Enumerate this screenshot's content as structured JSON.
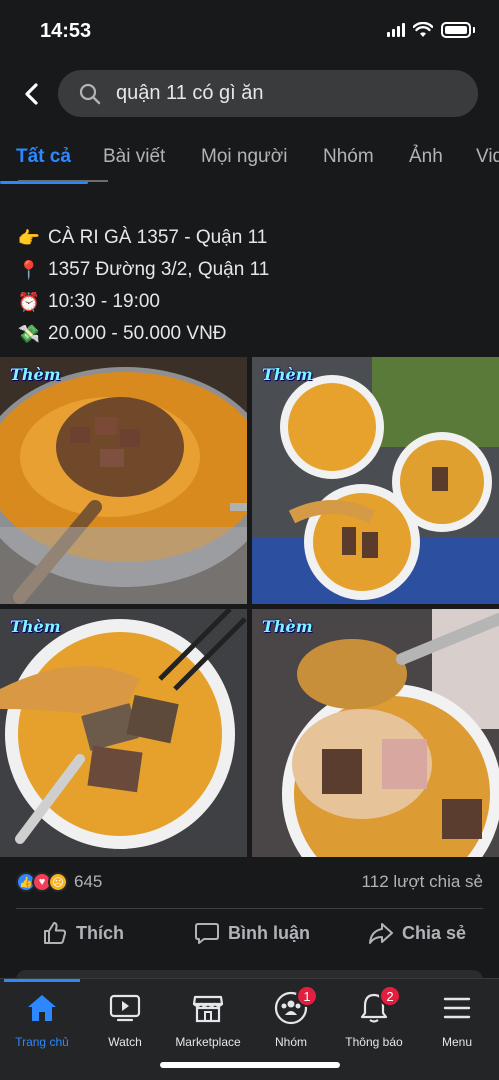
{
  "status_bar": {
    "time": "14:53"
  },
  "search": {
    "query": "quận 11 có gì ăn"
  },
  "tabs": [
    {
      "label": "Tất cả",
      "active": true
    },
    {
      "label": "Bài viết"
    },
    {
      "label": "Mọi người"
    },
    {
      "label": "Nhóm"
    },
    {
      "label": "Ảnh"
    },
    {
      "label": "Vid"
    }
  ],
  "post": {
    "lines": [
      {
        "icon": "pointing-hand-icon",
        "glyph": "👉",
        "text": "CÀ RI GÀ 1357 - Quận 11"
      },
      {
        "icon": "pin-icon",
        "glyph": "📍",
        "text": "1357 Đường 3/2, Quận 11"
      },
      {
        "icon": "alarm-clock-icon",
        "glyph": "⏰",
        "text": "10:30 - 19:00"
      },
      {
        "icon": "money-icon",
        "glyph": "💸",
        "text": "20.000 - 50.000 VNĐ"
      }
    ],
    "photo_tag": "Thèm",
    "reactions": {
      "count": "645",
      "shares": "112 lượt chia sẻ"
    },
    "actions": {
      "like": "Thích",
      "comment": "Bình luận",
      "share": "Chia sẻ"
    }
  },
  "bottom_nav": [
    {
      "label": "Trang chủ",
      "icon": "home-icon",
      "active": true
    },
    {
      "label": "Watch",
      "icon": "watch-icon"
    },
    {
      "label": "Marketplace",
      "icon": "marketplace-icon"
    },
    {
      "label": "Nhóm",
      "icon": "groups-icon",
      "badge": "1"
    },
    {
      "label": "Thông báo",
      "icon": "bell-icon",
      "badge": "2"
    },
    {
      "label": "Menu",
      "icon": "menu-icon"
    }
  ],
  "colors": {
    "accent": "#2d88ff",
    "background": "#18191a",
    "badge": "#e41e3f"
  }
}
